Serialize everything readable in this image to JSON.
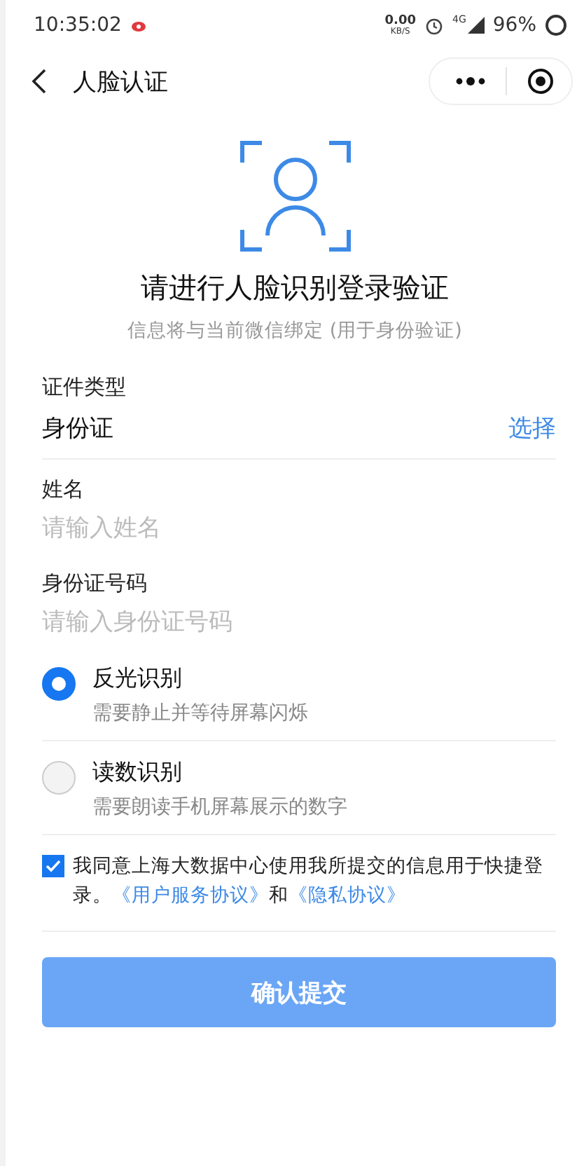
{
  "status_bar": {
    "time": "10:35:02",
    "speed": "0.00",
    "speed_unit": "KB/S",
    "network": "4G",
    "battery": "96%"
  },
  "nav": {
    "title": "人脸认证"
  },
  "header": {
    "title": "请进行人脸识别登录验证",
    "subtitle": "信息将与当前微信绑定 (用于身份验证)"
  },
  "fields": [
    {
      "kind": "select",
      "label": "证件类型",
      "value": "身份证",
      "action": "选择"
    },
    {
      "kind": "input",
      "label": "姓名",
      "placeholder": "请输入姓名"
    },
    {
      "kind": "input",
      "label": "身份证号码",
      "placeholder": "请输入身份证号码"
    }
  ],
  "methods": [
    {
      "title": "反光识别",
      "description": "需要静止并等待屏幕闪烁",
      "selected": true
    },
    {
      "title": "读数识别",
      "description": "需要朗读手机屏幕展示的数字",
      "selected": false
    }
  ],
  "agreement": {
    "checked": true,
    "parts": [
      {
        "kind": "text",
        "text": "我同意上海大数据中心使用我所提交的信息用于快捷登录。"
      },
      {
        "kind": "link",
        "text": "《用户服务协议》"
      },
      {
        "kind": "text",
        "text": "和"
      },
      {
        "kind": "link",
        "text": "《隐私协议》"
      }
    ]
  },
  "submit": {
    "label": "确认提交"
  }
}
